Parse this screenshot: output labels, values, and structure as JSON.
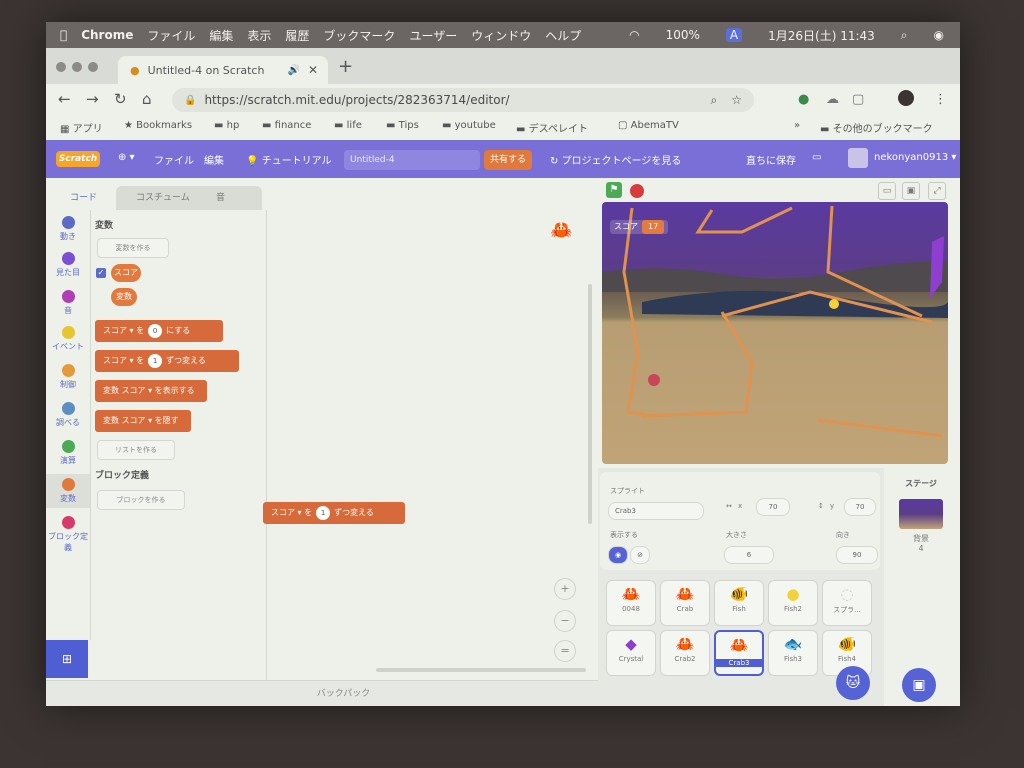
{
  "macbar": {
    "apple": "",
    "app": "Chrome",
    "menus": [
      "ファイル",
      "編集",
      "表示",
      "履歴",
      "ブックマーク",
      "ユーザー",
      "ウィンドウ",
      "ヘルプ"
    ],
    "battery": "100%",
    "user_initial": "A",
    "datetime": "1月26日(土) 11:43"
  },
  "browser": {
    "tab_title": "Untitled-4 on Scratch",
    "url": "https://scratch.mit.edu/projects/282363714/editor/",
    "bookmarks": [
      "アプリ",
      "Bookmarks",
      "hp",
      "finance",
      "life",
      "Tips",
      "youtube",
      "デスペレイト",
      "AbemaTV"
    ],
    "bookmarks_more": "»",
    "other_bookmarks": "その他のブックマーク"
  },
  "scratch_menu": {
    "logo": "Scratch",
    "file": "ファイル",
    "edit": "編集",
    "tutorial": "チュートリアル",
    "project_name": "Untitled-4",
    "share": "共有する",
    "project_page": "プロジェクトページを見る",
    "save": "直ちに保存",
    "username": "nekonyan0913"
  },
  "editor_tabs": [
    "コード",
    "コスチューム",
    "音"
  ],
  "categories": [
    {
      "label": "動き",
      "color": "#5c6bc4"
    },
    {
      "label": "見た目",
      "color": "#7a4fd1"
    },
    {
      "label": "音",
      "color": "#b03fb6"
    },
    {
      "label": "イベント",
      "color": "#e6c531"
    },
    {
      "label": "制御",
      "color": "#e39a3a"
    },
    {
      "label": "調べる",
      "color": "#5b8fc0"
    },
    {
      "label": "演算",
      "color": "#4caa55"
    },
    {
      "label": "変数",
      "color": "#e07a3c"
    },
    {
      "label": "ブロック定義",
      "color": "#d63a6a"
    }
  ],
  "flyout": {
    "section_variables": "変数",
    "make_variable": "変数を作る",
    "var_score": "スコア",
    "var_hensu": "変数",
    "block_set": {
      "var": "スコア ▾",
      "wo": "を",
      "value": "0",
      "suffix": "にする"
    },
    "block_change": {
      "var": "スコア ▾",
      "wo": "を",
      "value": "1",
      "suffix": "ずつ変える"
    },
    "block_show": {
      "prefix": "変数",
      "var": "スコア ▾",
      "suffix": "を表示する"
    },
    "block_hide": {
      "prefix": "変数",
      "var": "スコア ▾",
      "suffix": "を隠す"
    },
    "make_list": "リストを作る",
    "section_myblocks": "ブロック定義",
    "make_block": "ブロックを作る"
  },
  "workspace": {
    "block": {
      "var": "スコア ▾",
      "wo": "を",
      "value": "1",
      "suffix": "ずつ変える"
    },
    "zoom_in": "+",
    "zoom_out": "−",
    "zoom_reset": "="
  },
  "backpack": "バックパック",
  "stage": {
    "score_label": "スコア",
    "score_value": "17"
  },
  "sprite_info": {
    "label_sprite": "スプライト",
    "name": "Crab3",
    "x_label": "x",
    "x": "70",
    "y_label": "y",
    "y": "70",
    "label_show": "表示する",
    "label_size": "大きさ",
    "size": "6",
    "label_direction": "向き",
    "direction": "90"
  },
  "sprites": [
    {
      "name": "0048",
      "icon": "🦀",
      "color": "#d7663f"
    },
    {
      "name": "Crab",
      "icon": "🦀",
      "color": "#c9455a"
    },
    {
      "name": "Fish",
      "icon": "🐠",
      "color": "#e04848"
    },
    {
      "name": "Fish2",
      "icon": "●",
      "color": "#f2d23a"
    },
    {
      "name": "スプラ...",
      "icon": "◌",
      "color": "#cccccc"
    },
    {
      "name": "Crystal",
      "icon": "◆",
      "color": "#8f3fcf"
    },
    {
      "name": "Crab2",
      "icon": "🦀",
      "color": "#c9455a"
    },
    {
      "name": "Crab3",
      "icon": "🦀",
      "color": "#c9455a"
    },
    {
      "name": "Fish3",
      "icon": "🐟",
      "color": "#3a5ec2"
    },
    {
      "name": "Fish4",
      "icon": "🐠",
      "color": "#e8c531"
    }
  ],
  "stage_col": {
    "title": "ステージ",
    "label": "背景",
    "count": "4"
  }
}
